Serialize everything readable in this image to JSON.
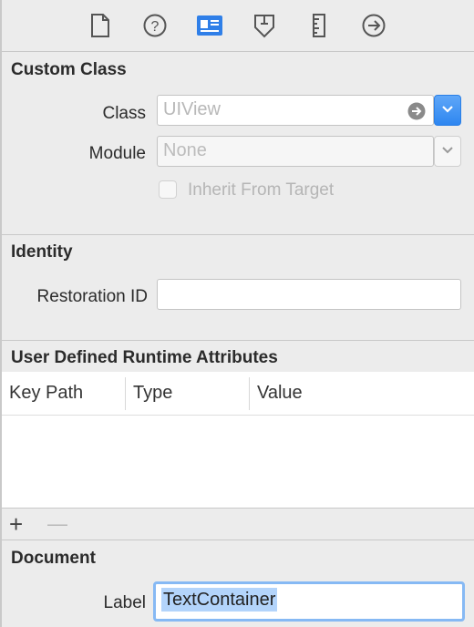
{
  "toolbar": {
    "icons": [
      "file-inspector-icon",
      "quick-help-icon",
      "identity-inspector-icon",
      "attributes-inspector-icon",
      "size-inspector-icon",
      "connections-inspector-icon"
    ],
    "active": "identity-inspector-icon",
    "accent": "#2f7fe8"
  },
  "custom_class": {
    "title": "Custom Class",
    "class_label": "Class",
    "class_placeholder": "UIView",
    "module_label": "Module",
    "module_placeholder": "None",
    "inherit_label": "Inherit From Target"
  },
  "identity": {
    "title": "Identity",
    "restoration_label": "Restoration ID",
    "restoration_value": ""
  },
  "runtime_attributes": {
    "title": "User Defined Runtime Attributes",
    "columns": [
      "Key Path",
      "Type",
      "Value"
    ],
    "add_label": "+",
    "remove_label": "—"
  },
  "document": {
    "title": "Document",
    "label_label": "Label",
    "label_value": "TextContainer"
  }
}
